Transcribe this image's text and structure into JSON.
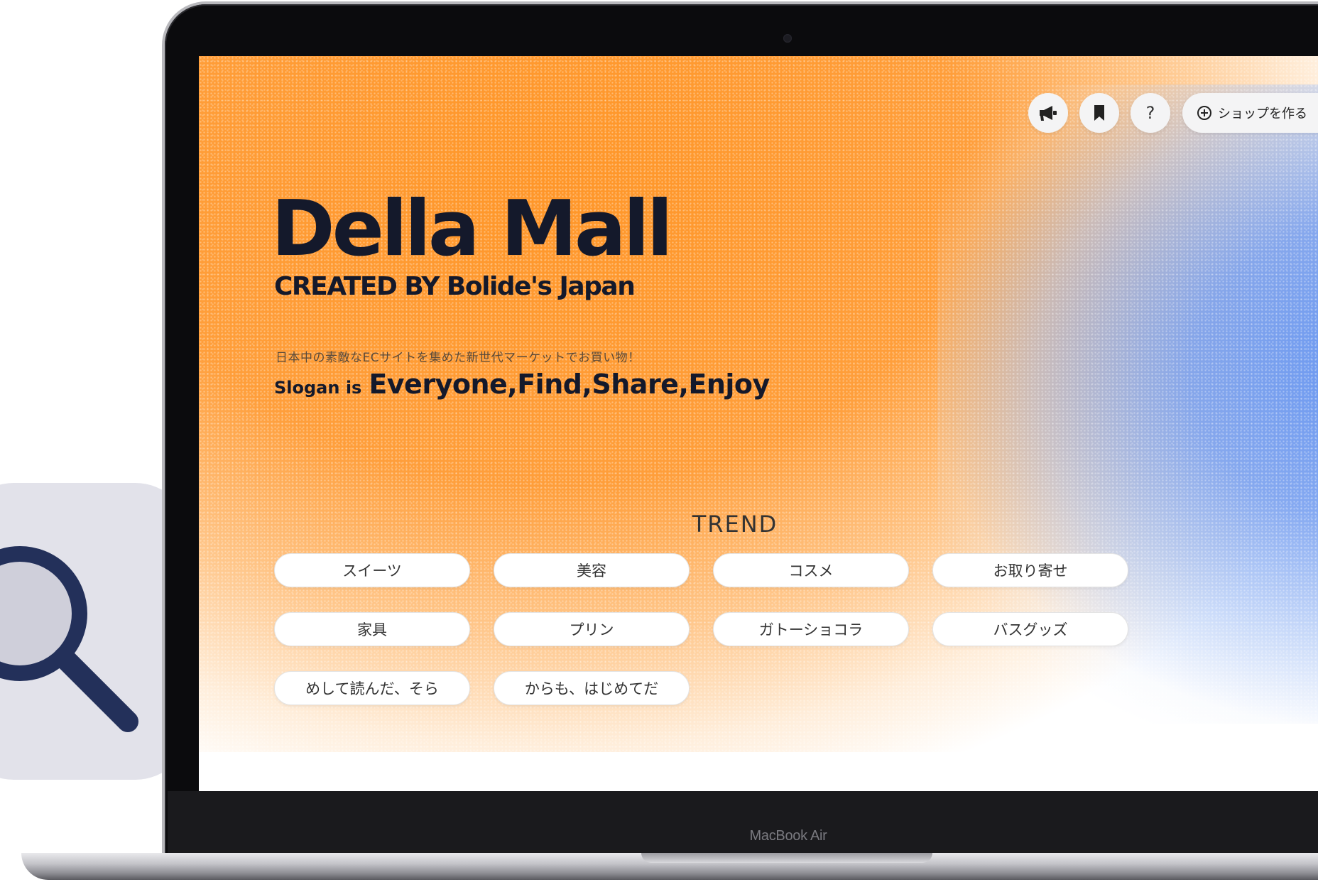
{
  "device": {
    "model_label": "MacBook Air"
  },
  "nav": {
    "create_shop_label": "ショップを作る"
  },
  "hero": {
    "title": "Della Mall",
    "subtitle": "CREATED BY Bolide's Japan",
    "tagline": "日本中の素敵なECサイトを集めた新世代マーケットでお買い物！",
    "slogan_prefix": "Slogan is",
    "slogan": "Everyone,Find,Share,Enjoy"
  },
  "trend": {
    "heading": "TREND",
    "tags": [
      "スイーツ",
      "美容",
      "コスメ",
      "お取り寄せ",
      "家具",
      "プリン",
      "ガトーショコラ",
      "バスグッズ",
      "めして読んだ、そら",
      "からも、はじめてだ"
    ]
  },
  "colors": {
    "orange": "#ff9628",
    "blue": "#6896f0",
    "ink": "#14192b",
    "search_card": "#e2e2ea",
    "magnifier": "#23305a"
  },
  "icons": {
    "announce": "megaphone-icon",
    "bookmark": "bookmark-icon",
    "help": "question-icon",
    "create": "plus-circle-icon",
    "search": "magnifier-icon"
  }
}
